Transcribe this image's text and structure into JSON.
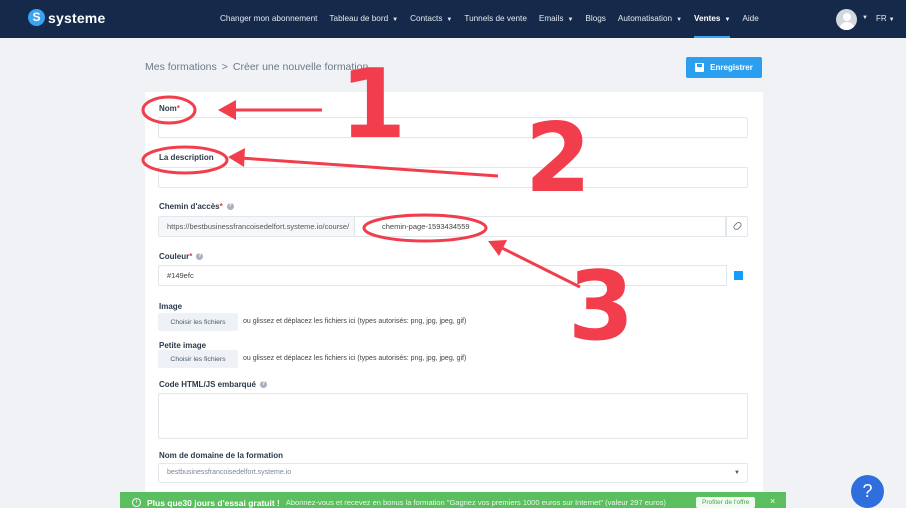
{
  "brand": {
    "name": "systeme"
  },
  "nav": {
    "items": [
      {
        "label": "Changer mon abonnement",
        "dropdown": false,
        "active": false
      },
      {
        "label": "Tableau de bord",
        "dropdown": true,
        "active": false
      },
      {
        "label": "Contacts",
        "dropdown": true,
        "active": false
      },
      {
        "label": "Tunnels de vente",
        "dropdown": false,
        "active": false
      },
      {
        "label": "Emails",
        "dropdown": true,
        "active": false
      },
      {
        "label": "Blogs",
        "dropdown": false,
        "active": false
      },
      {
        "label": "Automatisation",
        "dropdown": true,
        "active": false
      },
      {
        "label": "Ventes",
        "dropdown": true,
        "active": true
      },
      {
        "label": "Aide",
        "dropdown": false,
        "active": false
      }
    ],
    "language": "FR"
  },
  "breadcrumb": {
    "parent": "Mes formations",
    "separator": ">",
    "current": "Créer une nouvelle formation"
  },
  "toolbar": {
    "save_label": "Enregistrer"
  },
  "form": {
    "name_label": "Nom",
    "description_label": "La description",
    "path_label": "Chemin d'accès",
    "path_prefix": "https://bestbusinessfrancoisedelfort.systeme.io/course/",
    "path_value": "chemin-page-1593434559",
    "color_label": "Couleur",
    "color_value": "#149efc",
    "image_label": "Image",
    "small_image_label": "Petite image",
    "choose_files": "Choisir les fichiers",
    "drop_hint": "ou glissez et déplacez les fichiers ici (types autorisés: png, jpg, jpeg, gif)",
    "embed_label": "Code HTML/JS embarqué",
    "domain_label": "Nom de domaine de la formation",
    "domain_value": "bestbusinessfrancoisedelfort.systeme.io",
    "required_mark": "*",
    "help_mark": "?"
  },
  "annotations": {
    "numbers": [
      "1",
      "2",
      "3"
    ],
    "color": "#f23d4c"
  },
  "promo": {
    "info_mark": "i",
    "strong": "Plus que30 jours d'essai gratuit !",
    "text": "Abonnez-vous et recevez en bonus la formation \"Gagnez vos premiers 1000 euros sur Internet\" (valeur 297 euros)",
    "button": "Profiter de l'offre",
    "close": "×"
  },
  "help_bubble": "?",
  "colors": {
    "topbar": "#15294b",
    "accent": "#2a9ff0",
    "promo": "#5cbf5f",
    "help": "#2f6fdb"
  }
}
